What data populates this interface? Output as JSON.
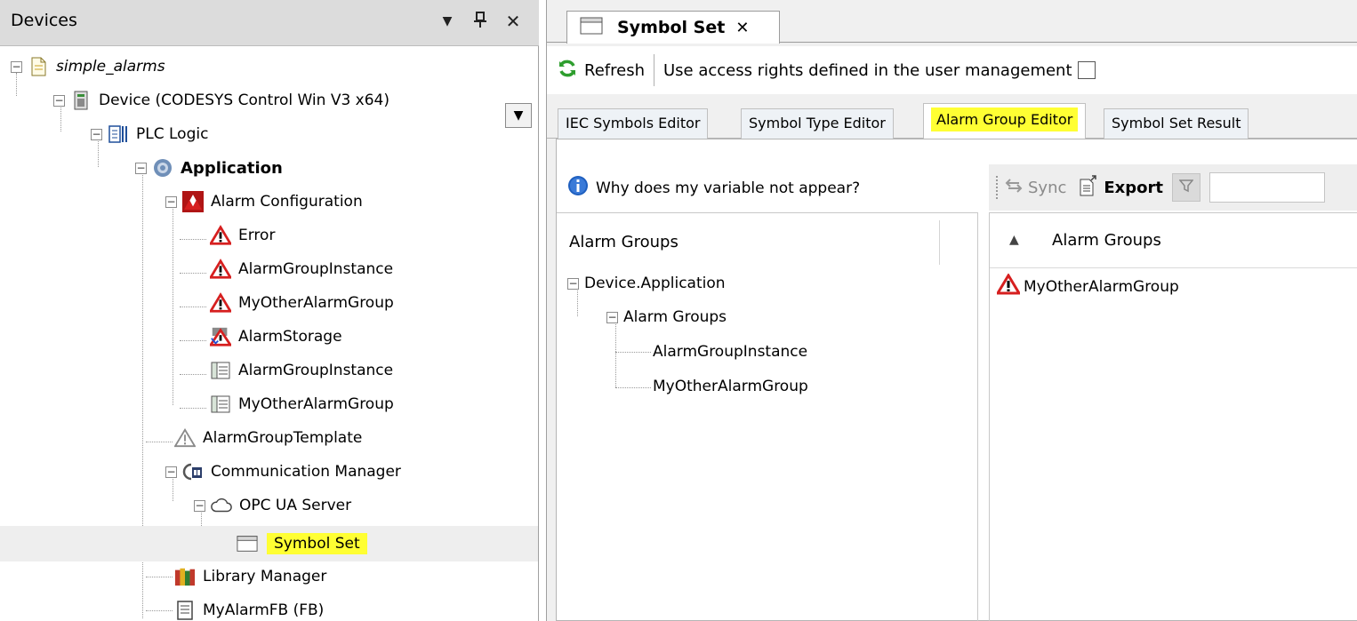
{
  "devices_panel": {
    "title": "Devices",
    "tree": [
      {
        "label": "simple_alarms"
      },
      {
        "label": "Device (CODESYS Control Win V3 x64)"
      },
      {
        "label": "PLC Logic"
      },
      {
        "label": "Application"
      },
      {
        "label": "Alarm Configuration"
      },
      {
        "label": "Error"
      },
      {
        "label": "AlarmGroupInstance"
      },
      {
        "label": "MyOtherAlarmGroup"
      },
      {
        "label": "AlarmStorage"
      },
      {
        "label": "AlarmGroupInstance"
      },
      {
        "label": "MyOtherAlarmGroup"
      },
      {
        "label": "AlarmGroupTemplate"
      },
      {
        "label": "Communication Manager"
      },
      {
        "label": "OPC UA Server"
      },
      {
        "label": "Symbol Set"
      },
      {
        "label": "Library Manager"
      },
      {
        "label": "MyAlarmFB (FB)"
      }
    ]
  },
  "editor": {
    "tab_label": "Symbol Set",
    "toolbar": {
      "refresh_label": "Refresh",
      "access_label": "Use access rights defined in the user management"
    },
    "sub_tabs": [
      {
        "label": "IEC Symbols Editor"
      },
      {
        "label": "Symbol Type Editor"
      },
      {
        "label": "Alarm Group Editor"
      },
      {
        "label": "Symbol Set Result"
      }
    ],
    "help_link": "Why does my variable not appear?",
    "actions": {
      "sync_label": "Sync",
      "export_label": "Export"
    },
    "left_pane": {
      "header": "Alarm Groups",
      "tree": [
        {
          "label": "Device.Application"
        },
        {
          "label": "Alarm Groups"
        },
        {
          "label": "AlarmGroupInstance"
        },
        {
          "label": "MyOtherAlarmGroup"
        }
      ]
    },
    "right_pane": {
      "header": "Alarm Groups",
      "items": [
        {
          "label": "MyOtherAlarmGroup"
        }
      ]
    }
  },
  "colors": {
    "highlight": "#ffff33",
    "panel_header": "#dcdcdc",
    "alarm_red": "#d61f1f"
  }
}
